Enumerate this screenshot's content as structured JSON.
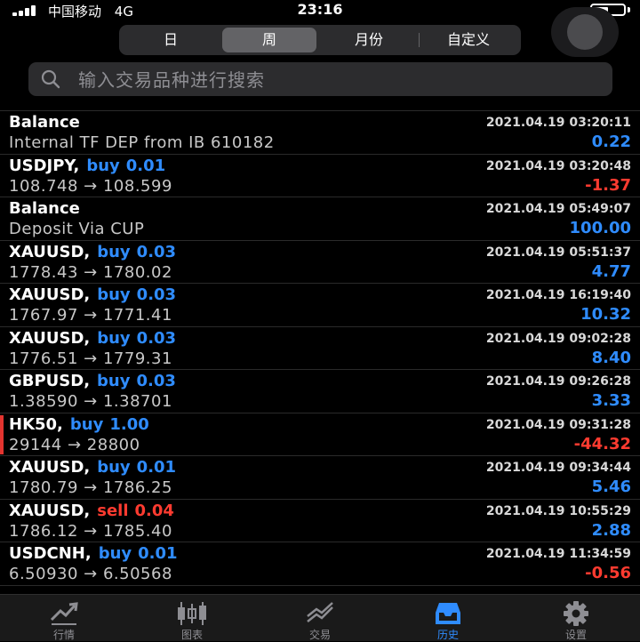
{
  "status_bar": {
    "carrier": "中国移动",
    "network": "4G",
    "time": "23:16"
  },
  "period_tabs": [
    {
      "label": "日",
      "active": false
    },
    {
      "label": "周",
      "active": true
    },
    {
      "label": "月份",
      "active": false
    },
    {
      "label": "自定义",
      "active": false
    }
  ],
  "search": {
    "placeholder": "输入交易品种进行搜索",
    "value": ""
  },
  "history": [
    {
      "symbol": "Balance",
      "action": "",
      "volume": "",
      "date": "2021.04.19 03:20:11",
      "detail": "Internal TF DEP from IB 610182",
      "amount": "0.22",
      "sign": "pos"
    },
    {
      "symbol": "USDJPY,",
      "action": "buy",
      "volume": "0.01",
      "date": "2021.04.19 03:20:48",
      "detail": "108.748 → 108.599",
      "amount": "-1.37",
      "sign": "neg"
    },
    {
      "symbol": "Balance",
      "action": "",
      "volume": "",
      "date": "2021.04.19 05:49:07",
      "detail": "Deposit Via CUP",
      "amount": "100.00",
      "sign": "pos"
    },
    {
      "symbol": "XAUUSD,",
      "action": "buy",
      "volume": "0.03",
      "date": "2021.04.19 05:51:37",
      "detail": "1778.43 → 1780.02",
      "amount": "4.77",
      "sign": "pos"
    },
    {
      "symbol": "XAUUSD,",
      "action": "buy",
      "volume": "0.03",
      "date": "2021.04.19 16:19:40",
      "detail": "1767.97 → 1771.41",
      "amount": "10.32",
      "sign": "pos"
    },
    {
      "symbol": "XAUUSD,",
      "action": "buy",
      "volume": "0.03",
      "date": "2021.04.19 09:02:28",
      "detail": "1776.51 → 1779.31",
      "amount": "8.40",
      "sign": "pos"
    },
    {
      "symbol": "GBPUSD,",
      "action": "buy",
      "volume": "0.03",
      "date": "2021.04.19 09:26:28",
      "detail": "1.38590 → 1.38701",
      "amount": "3.33",
      "sign": "pos"
    },
    {
      "symbol": "HK50,",
      "action": "buy",
      "volume": "1.00",
      "date": "2021.04.19 09:31:28",
      "detail": "29144 → 28800",
      "amount": "-44.32",
      "sign": "neg",
      "marked": true
    },
    {
      "symbol": "XAUUSD,",
      "action": "buy",
      "volume": "0.01",
      "date": "2021.04.19 09:34:44",
      "detail": "1780.79 → 1786.25",
      "amount": "5.46",
      "sign": "pos"
    },
    {
      "symbol": "XAUUSD,",
      "action": "sell",
      "volume": "0.04",
      "date": "2021.04.19 10:55:29",
      "detail": "1786.12 → 1785.40",
      "amount": "2.88",
      "sign": "pos"
    },
    {
      "symbol": "USDCNH,",
      "action": "buy",
      "volume": "0.01",
      "date": "2021.04.19 11:34:59",
      "detail": "6.50930 → 6.50568",
      "amount": "-0.56",
      "sign": "neg"
    }
  ],
  "tabbar": [
    {
      "label": "行情",
      "icon": "quotes-icon",
      "active": false
    },
    {
      "label": "图表",
      "icon": "chart-icon",
      "active": false
    },
    {
      "label": "交易",
      "icon": "trade-icon",
      "active": false
    },
    {
      "label": "历史",
      "icon": "history-icon",
      "active": true
    },
    {
      "label": "设置",
      "icon": "settings-icon",
      "active": false
    }
  ],
  "colors": {
    "buy": "#2f8cff",
    "sell": "#ff3b30",
    "accent": "#2f8cff"
  }
}
